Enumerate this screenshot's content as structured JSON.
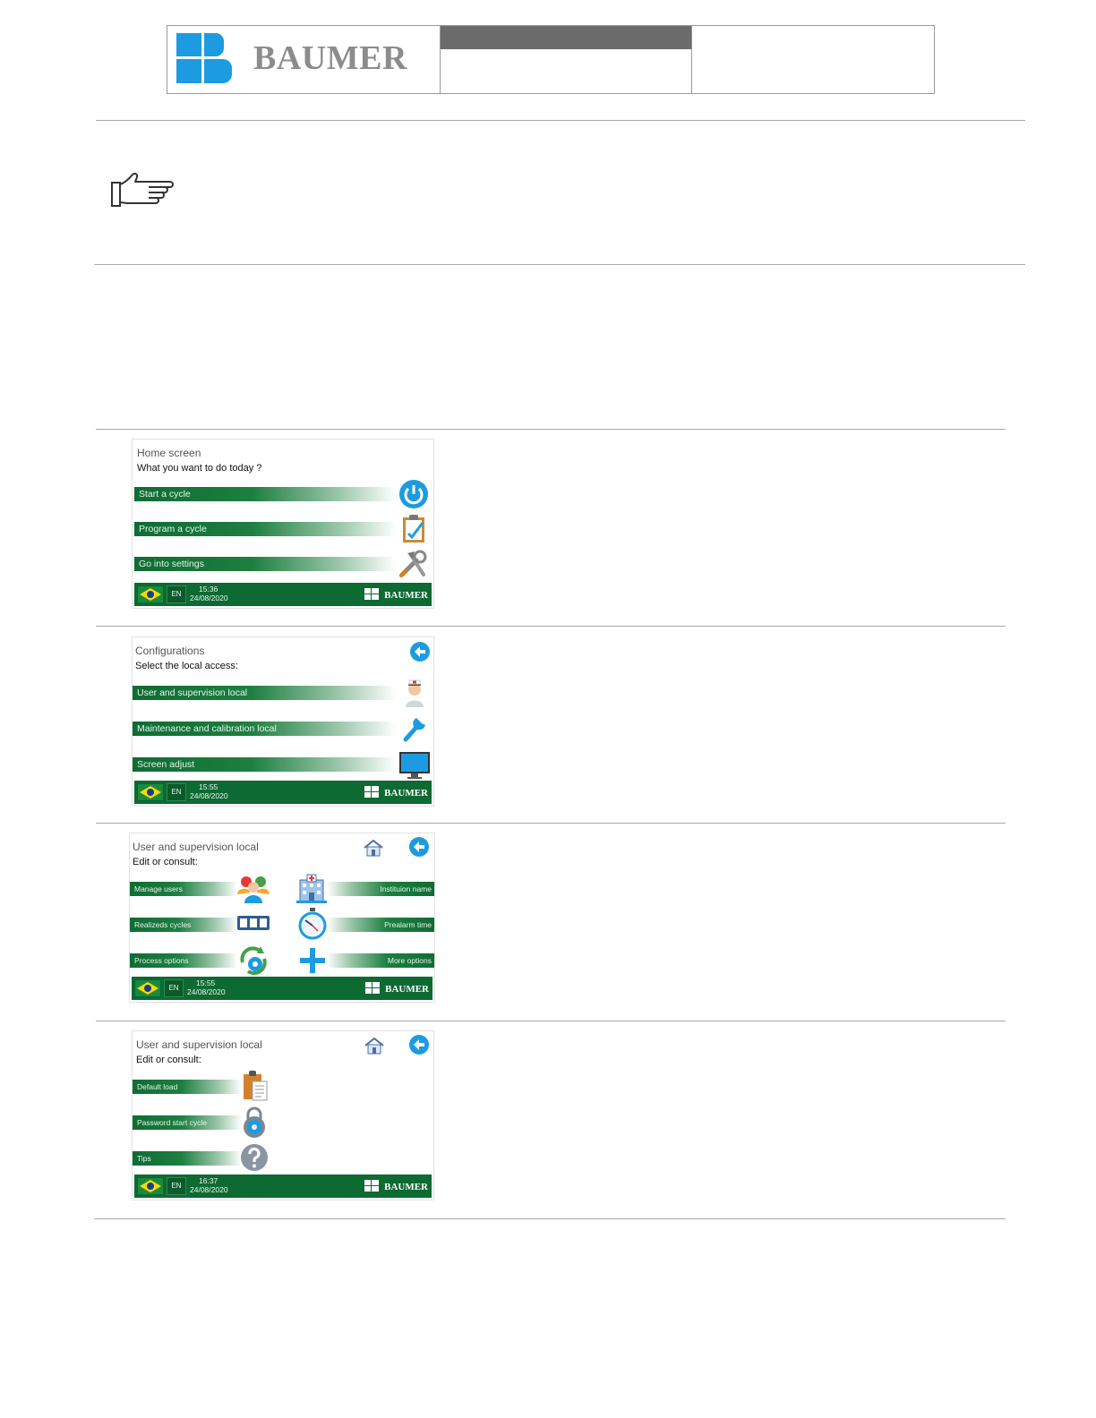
{
  "header": {
    "brand": "BAUMER",
    "brand_color": "#1d9be0"
  },
  "panels": [
    {
      "title": "Home screen",
      "subtitle": "What you want to do today ?",
      "items": [
        {
          "label": "Start a cycle",
          "icon": "power-icon"
        },
        {
          "label": "Program a cycle",
          "icon": "clipboard-edit-icon"
        },
        {
          "label": "Go into settings",
          "icon": "tools-icon"
        }
      ],
      "footer": {
        "lang": "EN",
        "time": "15:36",
        "date": "24/08/2020",
        "brand": "BAUMER"
      }
    },
    {
      "title": "Configurations",
      "subtitle": "Select the local access:",
      "items": [
        {
          "label": "User and supervision local",
          "icon": "nurse-icon"
        },
        {
          "label": "Maintenance and calibration local",
          "icon": "wrench-icon"
        },
        {
          "label": "Screen adjust",
          "icon": "monitor-icon"
        }
      ],
      "footer": {
        "lang": "EN",
        "time": "15:55",
        "date": "24/08/2020",
        "brand": "BAUMER"
      }
    },
    {
      "title": "User and supervision local",
      "subtitle": "Edit or consult:",
      "left_items": [
        {
          "label": "Manage users",
          "icon": "users-icon"
        },
        {
          "label": "Realizeds cycles",
          "icon": "counter-icon"
        },
        {
          "label": "Process options",
          "icon": "process-gear-icon"
        }
      ],
      "right_items": [
        {
          "label": "Instituion name",
          "icon": "hospital-icon"
        },
        {
          "label": "Prealarm time",
          "icon": "stopwatch-icon"
        },
        {
          "label": "More options",
          "icon": "plus-icon"
        }
      ],
      "footer": {
        "lang": "EN",
        "time": "15:55",
        "date": "24/08/2020",
        "brand": "BAUMER"
      }
    },
    {
      "title": "User and supervision local",
      "subtitle": "Edit or consult:",
      "items": [
        {
          "label": "Default load",
          "icon": "document-icon"
        },
        {
          "label": "Password start cycle",
          "icon": "padlock-icon"
        },
        {
          "label": "Tips",
          "icon": "help-icon"
        }
      ],
      "footer": {
        "lang": "EN",
        "time": "16:37",
        "date": "24/08/2020",
        "brand": "BAUMER"
      }
    }
  ]
}
